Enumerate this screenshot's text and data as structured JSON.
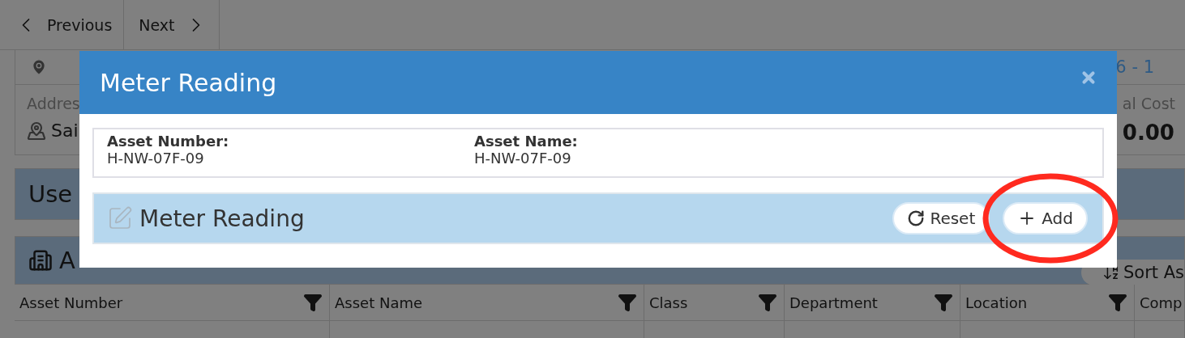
{
  "nav": {
    "buttons": [
      {
        "label": "Previous",
        "kind": "prev"
      },
      {
        "label": "Next",
        "kind": "next"
      }
    ]
  },
  "summary": {
    "link": "6 - 1",
    "address_label": "Addres",
    "address_value": "Sai",
    "cost_label": "al Cost",
    "cost_value": "0.00"
  },
  "sections": [
    {
      "title": "Use",
      "kind": "user"
    },
    {
      "title": "A",
      "kind": "assets",
      "button": "Sort As"
    }
  ],
  "table": {
    "columns": [
      "Asset Number",
      "Asset Name",
      "Class",
      "Department",
      "Location",
      "Comp"
    ]
  },
  "modal": {
    "title": "Meter Reading",
    "fields": [
      {
        "label": "Asset Number:",
        "value": "H-NW-07F-09"
      },
      {
        "label": "Asset Name:",
        "value": "H-NW-07F-09"
      }
    ],
    "section": {
      "title": "Meter Reading",
      "buttons": [
        {
          "label": "Reset",
          "kind": "reset",
          "highlighted": false
        },
        {
          "label": "Add",
          "kind": "add",
          "highlighted": true
        }
      ]
    }
  }
}
